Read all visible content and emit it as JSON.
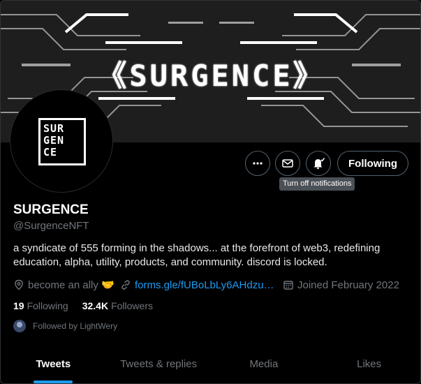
{
  "banner": {
    "title": "《SURGENCE》"
  },
  "avatar": {
    "lines": "SUR GEN CE"
  },
  "actions": {
    "more_icon": "more-icon",
    "message_icon": "envelope-icon",
    "notify_icon": "bell-check-icon",
    "following_label": "Following",
    "tooltip": "Turn off notifications"
  },
  "profile": {
    "name": "SURGENCE",
    "handle": "@SurgenceNFT",
    "bio": "a syndicate of 555 forming in the shadows... at the forefront of web3, redefining education, alpha, utility, products, and community. discord is locked.",
    "location": "become an ally 🤝",
    "link": "forms.gle/fUBoLbLy6AHdzu…",
    "joined": "Joined February 2022"
  },
  "stats": {
    "following_count": "19",
    "following_label": "Following",
    "followers_count": "32.4K",
    "followers_label": "Followers"
  },
  "followed_by": "Followed by LightWery",
  "tabs": [
    {
      "label": "Tweets"
    },
    {
      "label": "Tweets & replies"
    },
    {
      "label": "Media"
    },
    {
      "label": "Likes"
    }
  ],
  "colors": {
    "accent": "#1d9bf0",
    "muted": "#71767b",
    "bg": "#000000"
  }
}
